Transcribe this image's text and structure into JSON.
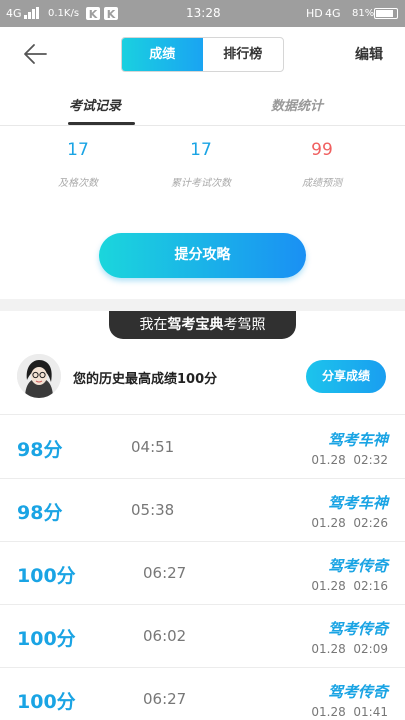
{
  "status_bar": {
    "network_left": "4G",
    "speed": "0.1K/s",
    "app_badge": "K",
    "time": "13:28",
    "hd": "HD",
    "network_right": "4G",
    "battery": "81%"
  },
  "header": {
    "segments": [
      "成绩",
      "排行榜"
    ],
    "active_segment": 0,
    "edit_label": "编辑"
  },
  "tabs": [
    "考试记录",
    "数据统计"
  ],
  "stats": [
    {
      "value": "17",
      "label": "及格次数",
      "color": "#1aa4e4"
    },
    {
      "value": "17",
      "label": "累计考试次数",
      "color": "#1aa4e4"
    },
    {
      "value": "99",
      "label": "成绩预测",
      "color": "#f06060"
    }
  ],
  "tips_button": "提分攻略",
  "banner": {
    "prefix": "我在",
    "brand": "驾考宝典",
    "suffix": "考驾照"
  },
  "best": {
    "text": "您的历史最高成绩100分",
    "share_label": "分享成绩"
  },
  "records": [
    {
      "score": "98分",
      "duration": "04:51",
      "title": "驾考车神",
      "date": "01.28",
      "time": "02:32"
    },
    {
      "score": "98分",
      "duration": "05:38",
      "title": "驾考车神",
      "date": "01.28",
      "time": "02:26"
    },
    {
      "score": "100分",
      "duration": "06:27",
      "title": "驾考传奇",
      "date": "01.28",
      "time": "02:16"
    },
    {
      "score": "100分",
      "duration": "06:02",
      "title": "驾考传奇",
      "date": "01.28",
      "time": "02:09"
    },
    {
      "score": "100分",
      "duration": "06:27",
      "title": "驾考传奇",
      "date": "01.28",
      "time": "01:41"
    }
  ],
  "colors": {
    "accent": "#1aa4e4",
    "gradient_start": "#1bd6dc",
    "gradient_end": "#1a90f4",
    "prediction": "#f06060"
  }
}
